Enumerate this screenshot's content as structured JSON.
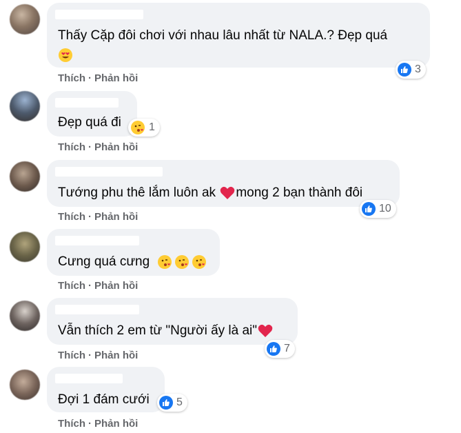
{
  "actions": {
    "like_label": "Thích",
    "separator": "·",
    "reply_label": "Phản hồi"
  },
  "colors": {
    "bubble": "#f0f2f5",
    "meta_text": "#65676b",
    "like_blue": "#1877f2",
    "heart_red": "#e2264d"
  },
  "comments": [
    {
      "text": "Thấy Cặp đôi chơi với nhau lâu nhất từ NALA.? Đẹp quá",
      "emoji": "heart-eyes-emoji",
      "reaction": "like-icon",
      "count": "3"
    },
    {
      "text": "Đẹp quá đi",
      "emoji": "",
      "reaction": "kiss-emoji",
      "count": "1"
    },
    {
      "text": "Tướng phu thê lắm luôn ak",
      "text2": "mong 2 bạn thành đôi",
      "emoji": "heart-emoji",
      "reaction": "like-icon",
      "count": "10"
    },
    {
      "text": "Cưng quá cưng",
      "emoji": "kiss-emoji ×3",
      "reaction": "",
      "count": ""
    },
    {
      "text": "Vẫn thích 2 em từ \"Người ấy là ai\"",
      "emoji": "heart-emoji",
      "reaction": "like-icon",
      "count": "7"
    },
    {
      "text": "Đợi 1 đám cưới",
      "emoji": "",
      "reaction": "like-icon",
      "count": "5"
    }
  ]
}
